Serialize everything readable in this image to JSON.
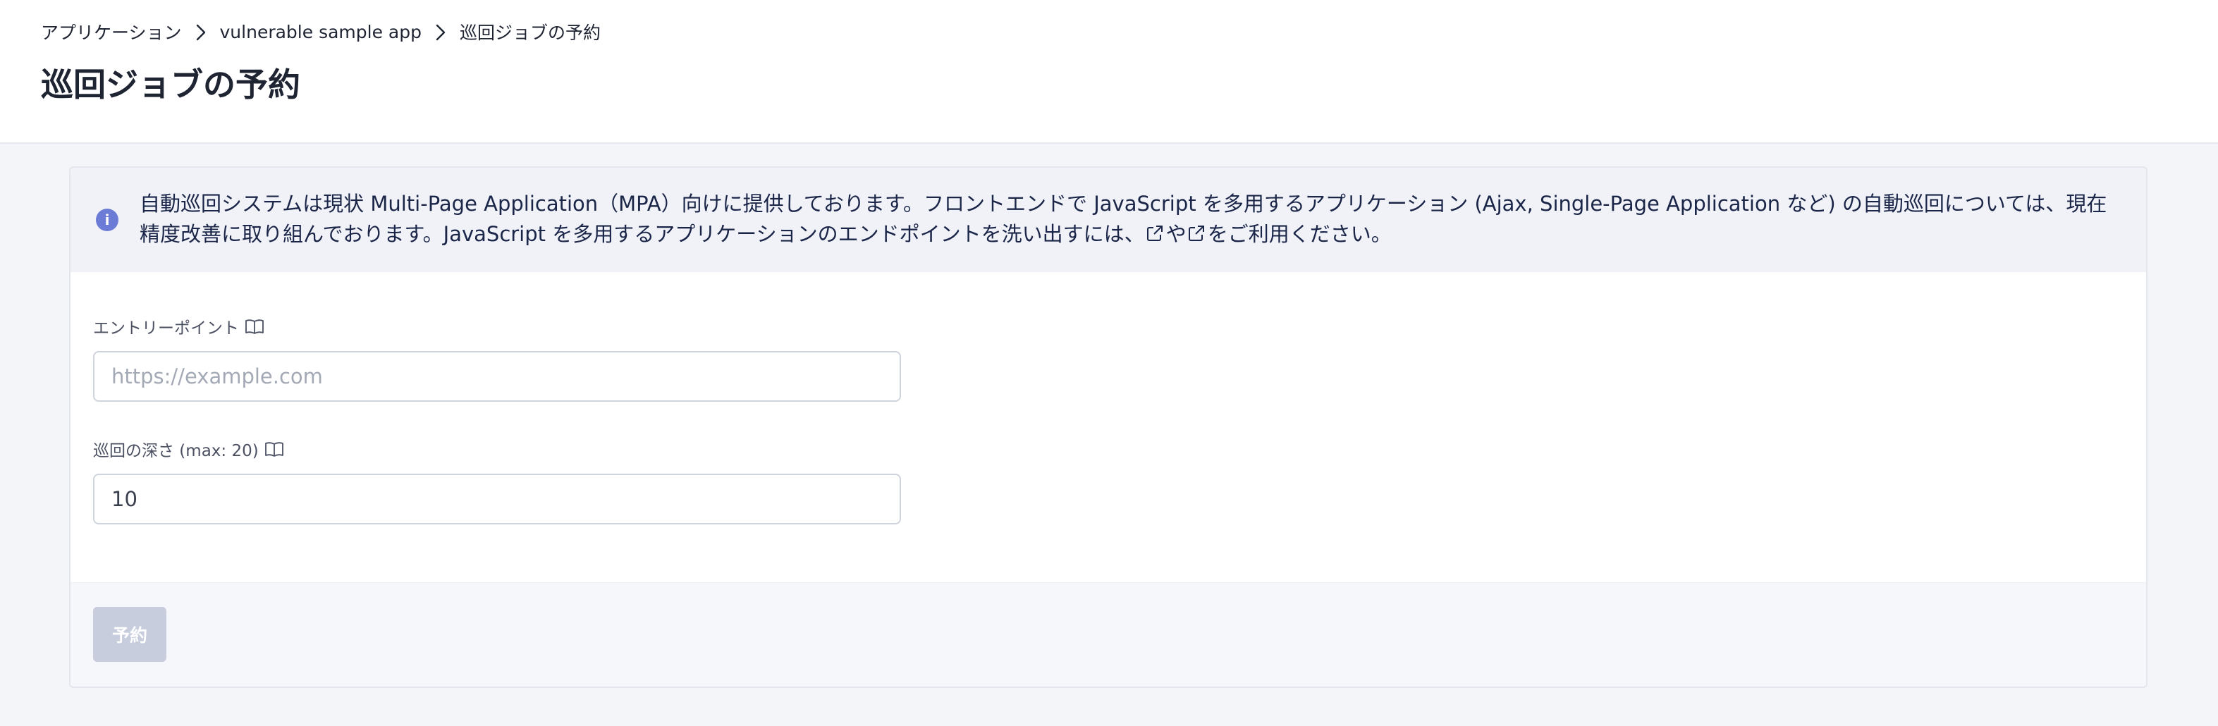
{
  "breadcrumb": {
    "items": [
      "アプリケーション",
      "vulnerable sample app",
      "巡回ジョブの予約"
    ]
  },
  "page_title": "巡回ジョブの予約",
  "notice": {
    "icon": "info-icon",
    "text_part1": "自動巡回システムは現状 Multi-Page Application（MPA）向けに提供しております。フロントエンドで JavaScript を多用するアプリケーション (Ajax, Single-Page Application など) の自動巡回については、現在精度改善に取り組んでおります。JavaScript を多用するアプリケーションのエンドポイントを洗い出すには、",
    "text_part2": "や",
    "text_part3": "をご利用ください。"
  },
  "form": {
    "entry_point": {
      "label": "エントリーポイント",
      "value": "",
      "placeholder": "https://example.com"
    },
    "depth": {
      "label": "巡回の深さ (max: 20)",
      "value": "10"
    }
  },
  "submit_label": "予約",
  "colors": {
    "accent": "#6c7bd6",
    "notice_bg": "#f0f2f8",
    "disabled_button": "#c7cddd"
  }
}
